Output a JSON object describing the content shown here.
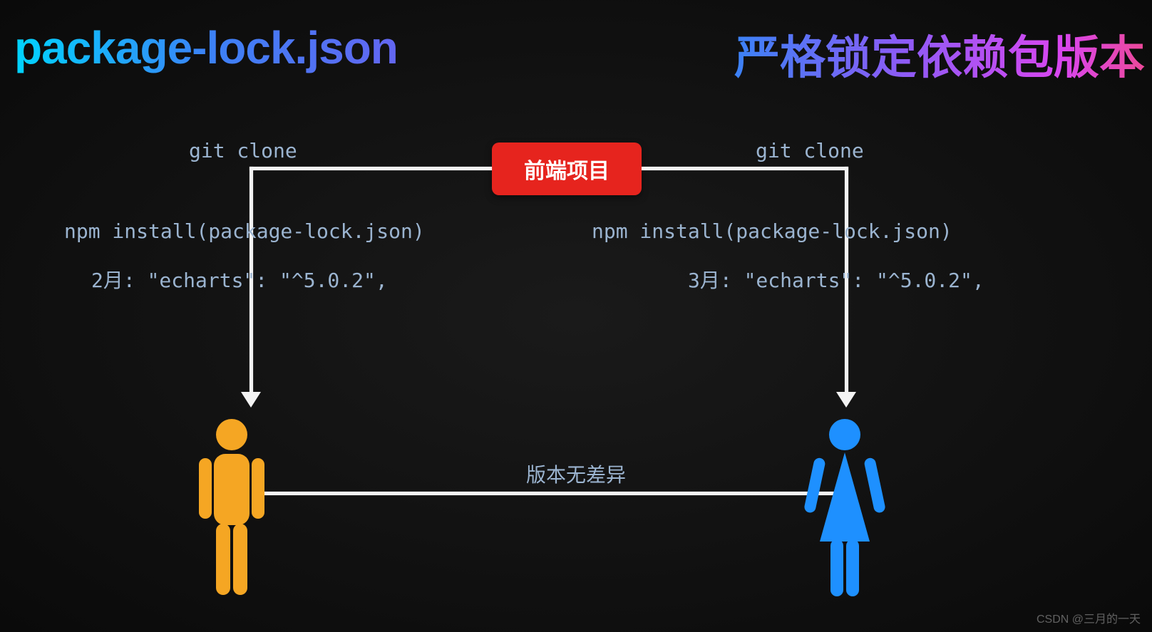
{
  "title": {
    "left": "package-lock.json",
    "right": "严格锁定依赖包版本"
  },
  "project_box": "前端项目",
  "left": {
    "git": "git clone",
    "npm": "npm install(package-lock.json)",
    "version": "2月: \"echarts\": \"^5.0.2\","
  },
  "right": {
    "git": "git clone",
    "npm": "npm install(package-lock.json)",
    "version": "3月: \"echarts\": \"^5.0.2\","
  },
  "center_label": "版本无差异",
  "watermark": "CSDN @三月的一天",
  "colors": {
    "person_left": "#f5a623",
    "person_right": "#1e90ff"
  }
}
